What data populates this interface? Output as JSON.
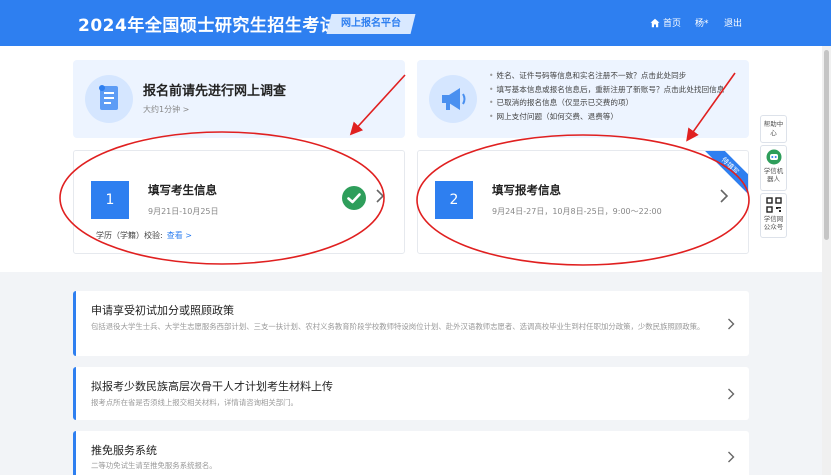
{
  "header": {
    "title": "2024年全国硕士研究生招生考试",
    "badge": "网上报名平台",
    "nav_home": "首页",
    "nav_user": "杨*",
    "nav_logout": "退出"
  },
  "survey": {
    "title": "报名前请先进行网上调查",
    "subtitle": "大约1分钟 >"
  },
  "notices": [
    "姓名、证件号码等信息和实名注册不一致？点击此处同步",
    "填写基本信息或报名信息后，重新注册了新账号？点击此处找回信息",
    "已取消的报名信息（仅显示已交费的项）",
    "网上支付问题（如何交费、退费等）"
  ],
  "steps": [
    {
      "number": "1",
      "title": "填写考生信息",
      "date": "9月21日-10月25日",
      "verify_label": "学历（学籍）校验:",
      "verify_link": "查看 >"
    },
    {
      "number": "2",
      "title": "填写报考信息",
      "date": "9月24日-27日，10月8日-25日，9:00～22:00",
      "ribbon": "待填写"
    }
  ],
  "float_panel": {
    "help": "帮助中心",
    "robot": "学信机器人",
    "qr": "学信网公众号"
  },
  "policies": [
    {
      "title": "申请享受初试加分或照顾政策",
      "desc": "包括退役大学生士兵、大学生志愿服务西部计划、三支一扶计划、农村义务教育阶段学校教师特设岗位计划、赴外汉语教师志愿者、选调高校毕业生到村任职加分政策，少数民族照顾政策。"
    },
    {
      "title": "拟报考少数民族高层次骨干人才计划考生材料上传",
      "desc": "报考点所在省是否须线上报交相关材料，详情请咨询相关部门。"
    },
    {
      "title": "推免服务系统",
      "desc": "二等功免试生请至推免服务系统报名。"
    }
  ],
  "colors": {
    "primary": "#2e7ff0",
    "success": "#2e9e5b",
    "annotation": "#e02020"
  }
}
